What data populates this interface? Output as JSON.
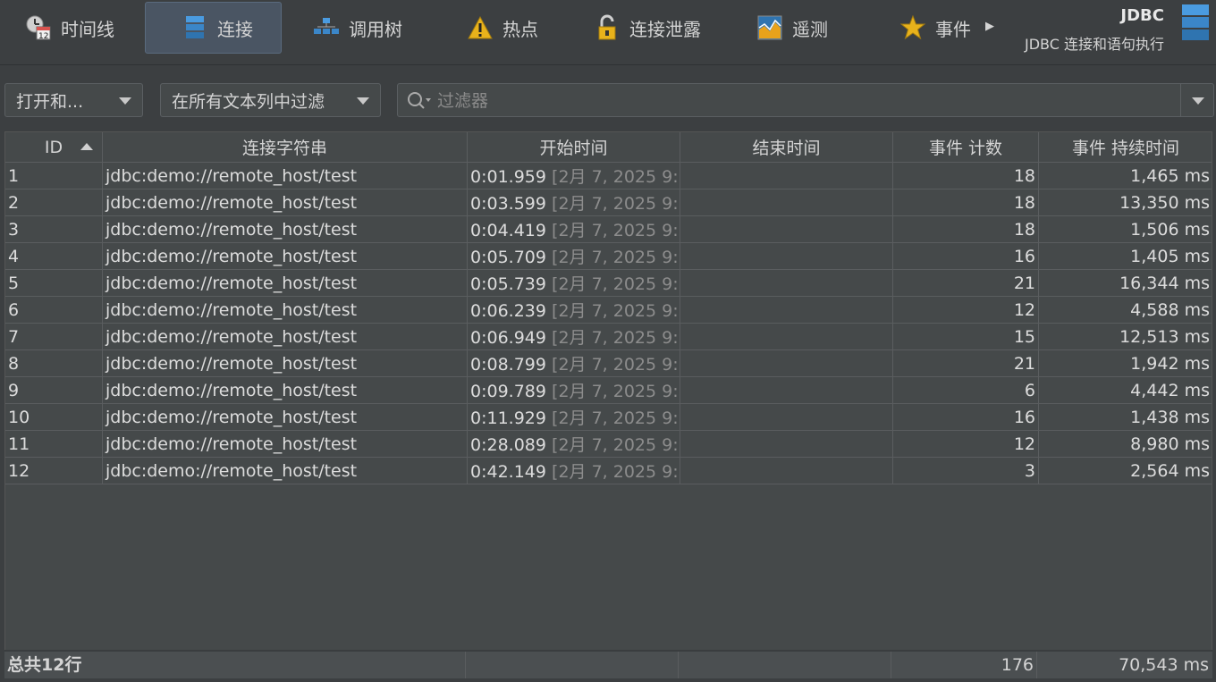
{
  "tabs": [
    {
      "label": "时间线",
      "icon": "timeline-clock-icon",
      "active": false
    },
    {
      "label": "连接",
      "icon": "database-stack-icon",
      "active": true
    },
    {
      "label": "调用树",
      "icon": "call-tree-icon",
      "active": false
    },
    {
      "label": "热点",
      "icon": "warning-hotspot-icon",
      "active": false
    },
    {
      "label": "连接泄露",
      "icon": "padlock-leak-icon",
      "active": false
    },
    {
      "label": "遥测",
      "icon": "telemetry-chart-icon",
      "active": false
    },
    {
      "label": "事件",
      "icon": "star-icon",
      "active": false
    }
  ],
  "brand": {
    "title": "JDBC",
    "subtitle": "JDBC 连接和语句执行",
    "icon": "database-stack-icon"
  },
  "controls": {
    "open_dropdown": "打开和...",
    "scope_dropdown": "在所有文本列中过滤",
    "filter_placeholder": "过滤器"
  },
  "columns": [
    "ID",
    "连接字符串",
    "开始时间",
    "结束时间",
    "事件 计数",
    "事件 持续时间"
  ],
  "rows": [
    {
      "id": "1",
      "conn": "jdbc:demo://remote_host/test",
      "start": "0:01.959",
      "start_dim": "[2月 7, 2025 9:...",
      "end": "",
      "count": "18",
      "duration": "1,465 ms"
    },
    {
      "id": "2",
      "conn": "jdbc:demo://remote_host/test",
      "start": "0:03.599",
      "start_dim": "[2月 7, 2025 9:...",
      "end": "",
      "count": "18",
      "duration": "13,350 ms"
    },
    {
      "id": "3",
      "conn": "jdbc:demo://remote_host/test",
      "start": "0:04.419",
      "start_dim": "[2月 7, 2025 9:...",
      "end": "",
      "count": "18",
      "duration": "1,506 ms"
    },
    {
      "id": "4",
      "conn": "jdbc:demo://remote_host/test",
      "start": "0:05.709",
      "start_dim": "[2月 7, 2025 9:...",
      "end": "",
      "count": "16",
      "duration": "1,405 ms"
    },
    {
      "id": "5",
      "conn": "jdbc:demo://remote_host/test",
      "start": "0:05.739",
      "start_dim": "[2月 7, 2025 9:...",
      "end": "",
      "count": "21",
      "duration": "16,344 ms"
    },
    {
      "id": "6",
      "conn": "jdbc:demo://remote_host/test",
      "start": "0:06.239",
      "start_dim": "[2月 7, 2025 9:...",
      "end": "",
      "count": "12",
      "duration": "4,588 ms"
    },
    {
      "id": "7",
      "conn": "jdbc:demo://remote_host/test",
      "start": "0:06.949",
      "start_dim": "[2月 7, 2025 9:...",
      "end": "",
      "count": "15",
      "duration": "12,513 ms"
    },
    {
      "id": "8",
      "conn": "jdbc:demo://remote_host/test",
      "start": "0:08.799",
      "start_dim": "[2月 7, 2025 9:...",
      "end": "",
      "count": "21",
      "duration": "1,942 ms"
    },
    {
      "id": "9",
      "conn": "jdbc:demo://remote_host/test",
      "start": "0:09.789",
      "start_dim": "[2月 7, 2025 9:...",
      "end": "",
      "count": "6",
      "duration": "4,442 ms"
    },
    {
      "id": "10",
      "conn": "jdbc:demo://remote_host/test",
      "start": "0:11.929",
      "start_dim": "[2月 7, 2025 9:...",
      "end": "",
      "count": "16",
      "duration": "1,438 ms"
    },
    {
      "id": "11",
      "conn": "jdbc:demo://remote_host/test",
      "start": "0:28.089",
      "start_dim": "[2月 7, 2025 9:...",
      "end": "",
      "count": "12",
      "duration": "8,980 ms"
    },
    {
      "id": "12",
      "conn": "jdbc:demo://remote_host/test",
      "start": "0:42.149",
      "start_dim": "[2月 7, 2025 9:...",
      "end": "",
      "count": "3",
      "duration": "2,564 ms"
    }
  ],
  "footer": {
    "total_prefix": "总共",
    "total_count": "12",
    "total_suffix": "行",
    "count_sum": "176",
    "duration_sum": "70,543 ms"
  },
  "colors": {
    "accent": "#4a88c7",
    "background": "#3c3f41",
    "warning": "#e8b21b"
  }
}
